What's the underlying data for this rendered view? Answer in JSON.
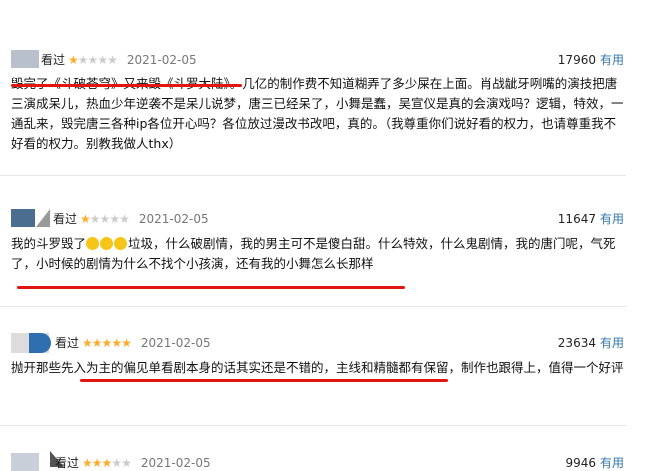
{
  "reviews": [
    {
      "status": "看过",
      "rating": 1,
      "date": "2021-02-05",
      "votes": "17960",
      "useful_label": "有用",
      "text": "毁完了《斗破苍穹》又来毁《斗罗大陆》。几亿的制作费不知道糊弄了多少屎在上面。肖战龇牙咧嘴的演技把唐三演成呆儿，热血少年逆袭不是呆儿说梦，唐三已经呆了，小舞是蠢，吴宣仪是真的会演戏吗？逻辑，特效，一通乱来，毁完唐三各种ip各位开心吗？各位放过漫改书改吧，真的。（我尊重你们说好看的权力，也请尊重我不好看的权力。别教我做人thx）"
    },
    {
      "status": "看过",
      "rating": 1,
      "date": "2021-02-05",
      "votes": "11647",
      "useful_label": "有用",
      "text_before_emoji": "我的斗罗毁了",
      "text_after_emoji": "垃圾，什么破剧情，我的男主可不是傻白甜。什么特效，什么鬼剧情，我的唐门呢，气死了，小时候的剧情为什么不找个小孩演，还有我的小舞怎么长那样"
    },
    {
      "status": "看过",
      "rating": 5,
      "date": "2021-02-05",
      "votes": "23634",
      "useful_label": "有用",
      "text": "抛开那些先入为主的偏见单看剧本身的话其实还是不错的，主线和精髓都有保留，制作也跟得上，值得一个好评"
    },
    {
      "status": "看过",
      "rating": 3,
      "date": "2021-02-05",
      "votes": "9946",
      "useful_label": "有用"
    }
  ],
  "colors": {
    "annotation": "#e3150f",
    "useful_link": "#3377aa",
    "star": "#ffac2d"
  },
  "icons": [
    "avatar",
    "star-icon",
    "crying-laughing-emoji"
  ]
}
